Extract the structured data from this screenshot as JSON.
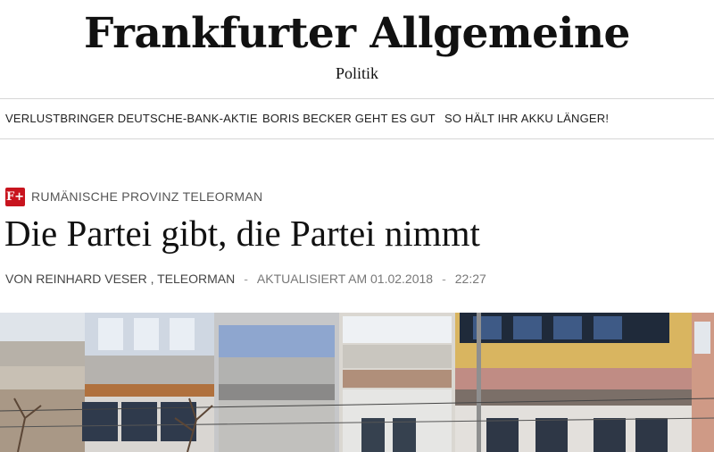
{
  "masthead": {
    "title": "Frankfurter Allgemeine",
    "section": "Politik"
  },
  "topnav": {
    "items": [
      "VERLUSTBRINGER DEUTSCHE-BANK-AKTIE",
      "BORIS BECKER GEHT ES GUT",
      "SO HÄLT IHR AKKU LÄNGER!"
    ]
  },
  "article": {
    "badge": "F+",
    "kicker": "RUMÄNISCHE PROVINZ TELEORMAN",
    "headline": "Die Partei gibt, die Partei nimmt",
    "byline": {
      "author": "VON REINHARD VESER , TELEORMAN",
      "separator": "-",
      "updated": "AKTUALISIERT AM 01.02.2018",
      "time": "22:27"
    }
  },
  "colors": {
    "brand_red": "#c8141e",
    "text": "#111111"
  },
  "photo": {
    "subject": "apartment-building-photo"
  }
}
